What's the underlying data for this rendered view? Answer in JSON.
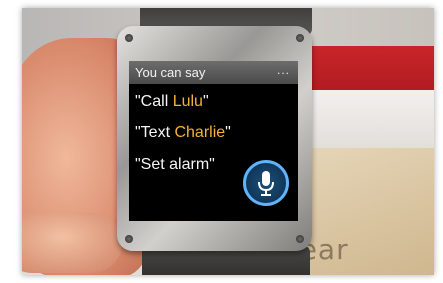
{
  "watch_ui": {
    "header": {
      "title": "You can say",
      "more_icon": "..."
    },
    "commands": [
      {
        "prefix": "\"Call ",
        "highlight": "Lulu",
        "suffix": "\""
      },
      {
        "prefix": "\"Text ",
        "highlight": "Charlie",
        "suffix": "\""
      },
      {
        "prefix": "\"Set alarm\"",
        "highlight": "",
        "suffix": ""
      }
    ],
    "mic_icon": "microphone-icon"
  },
  "scene": {
    "box_brand_text": "Gear"
  },
  "colors": {
    "highlight": "#f3b234",
    "mic_ring": "#5fb3ff"
  }
}
